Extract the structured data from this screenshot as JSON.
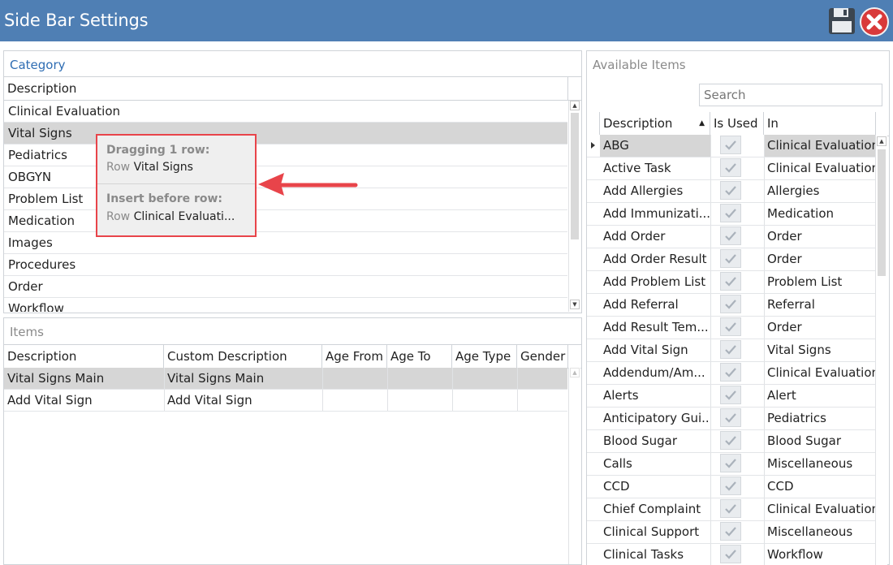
{
  "window": {
    "title": "Side Bar Settings"
  },
  "toolbar": {
    "save_icon": "floppy-disk-icon",
    "close_icon": "close-x-icon"
  },
  "category": {
    "title": "Category",
    "header": "Description",
    "rows": [
      "Clinical Evaluation",
      "Vital Signs",
      "Pediatrics",
      "OBGYN",
      "Problem List",
      "Medication",
      "Images",
      "Procedures",
      "Order",
      "Workflow"
    ],
    "selected_index": 1
  },
  "drag_tooltip": {
    "dragging_label": "Dragging 1 row:",
    "row_prefix": "Row",
    "dragging_row": "Vital Signs",
    "insert_label": "Insert before row:",
    "insert_row": "Clinical Evaluati..."
  },
  "items": {
    "title": "Items",
    "headers": [
      "Description",
      "Custom Description",
      "Age From",
      "Age To",
      "Age Type",
      "Gender"
    ],
    "rows": [
      [
        "Vital Signs Main",
        "Vital Signs Main",
        "",
        "",
        "",
        ""
      ],
      [
        "Add Vital Sign",
        "Add Vital Sign",
        "",
        "",
        "",
        ""
      ]
    ],
    "selected_index": 0
  },
  "available": {
    "title": "Available Items",
    "search_placeholder": "Search",
    "headers": [
      "Description",
      "Is Used",
      "In"
    ],
    "rows": [
      [
        "ABG",
        "Clinical Evaluation"
      ],
      [
        "Active Task",
        "Clinical Evaluation"
      ],
      [
        "Add Allergies",
        "Allergies"
      ],
      [
        "Add Immunizati...",
        "Medication"
      ],
      [
        "Add Order",
        "Order"
      ],
      [
        "Add Order Result",
        "Order"
      ],
      [
        "Add Problem List",
        "Problem List"
      ],
      [
        "Add Referral",
        "Referral"
      ],
      [
        "Add Result Tem...",
        "Order"
      ],
      [
        "Add Vital Sign",
        "Vital Signs"
      ],
      [
        "Addendum/Am...",
        "Clinical Evaluation"
      ],
      [
        "Alerts",
        "Alert"
      ],
      [
        "Anticipatory Gui...",
        "Pediatrics"
      ],
      [
        "Blood Sugar",
        "Blood Sugar"
      ],
      [
        "Calls",
        "Miscellaneous"
      ],
      [
        "CCD",
        "CCD"
      ],
      [
        "Chief Complaint",
        "Clinical Evaluation"
      ],
      [
        "Clinical Support",
        "Miscellaneous"
      ],
      [
        "Clinical Tasks",
        "Workflow"
      ]
    ],
    "selected_index": 0
  },
  "colors": {
    "titlebar": "#4f7fb4",
    "category_title": "#2f6db3",
    "tooltip_border": "#e8444a"
  }
}
